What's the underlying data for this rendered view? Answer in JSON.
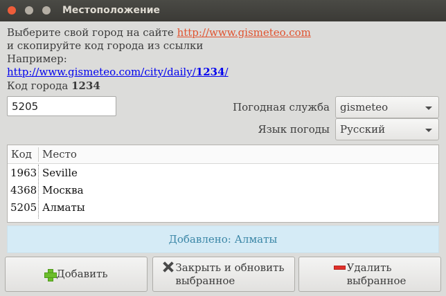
{
  "window": {
    "title": "Местоположение"
  },
  "info": {
    "line1_prefix": "Выберите свой город на сайте ",
    "line1_link": "http://www.gismeteo.com",
    "line2": "и скопируйте код города из ссылки",
    "line3": "Например:",
    "example_prefix": "http://www.gismeteo.com/city/daily/",
    "example_code": "1234",
    "example_suffix": "/",
    "code_label": "Код города ",
    "code_label_bold": "1234"
  },
  "code_input": {
    "value": "5205"
  },
  "service": {
    "label": "Погодная служба",
    "value": "gismeteo"
  },
  "language": {
    "label": "Язык погоды",
    "value": "Русский"
  },
  "table": {
    "headers": {
      "code": "Код",
      "place": "Место"
    },
    "rows": [
      {
        "code": "1963",
        "place": "Seville"
      },
      {
        "code": "4368",
        "place": "Москва"
      },
      {
        "code": "5205",
        "place": "Алматы"
      }
    ]
  },
  "status": {
    "text": "Добавлено: Алматы"
  },
  "buttons": {
    "add": "Добавить",
    "close_update_line1": "Закрыть и обновить",
    "close_update_line2": "выбранное",
    "delete_line1": "Удалить",
    "delete_line2": "выбранное"
  }
}
